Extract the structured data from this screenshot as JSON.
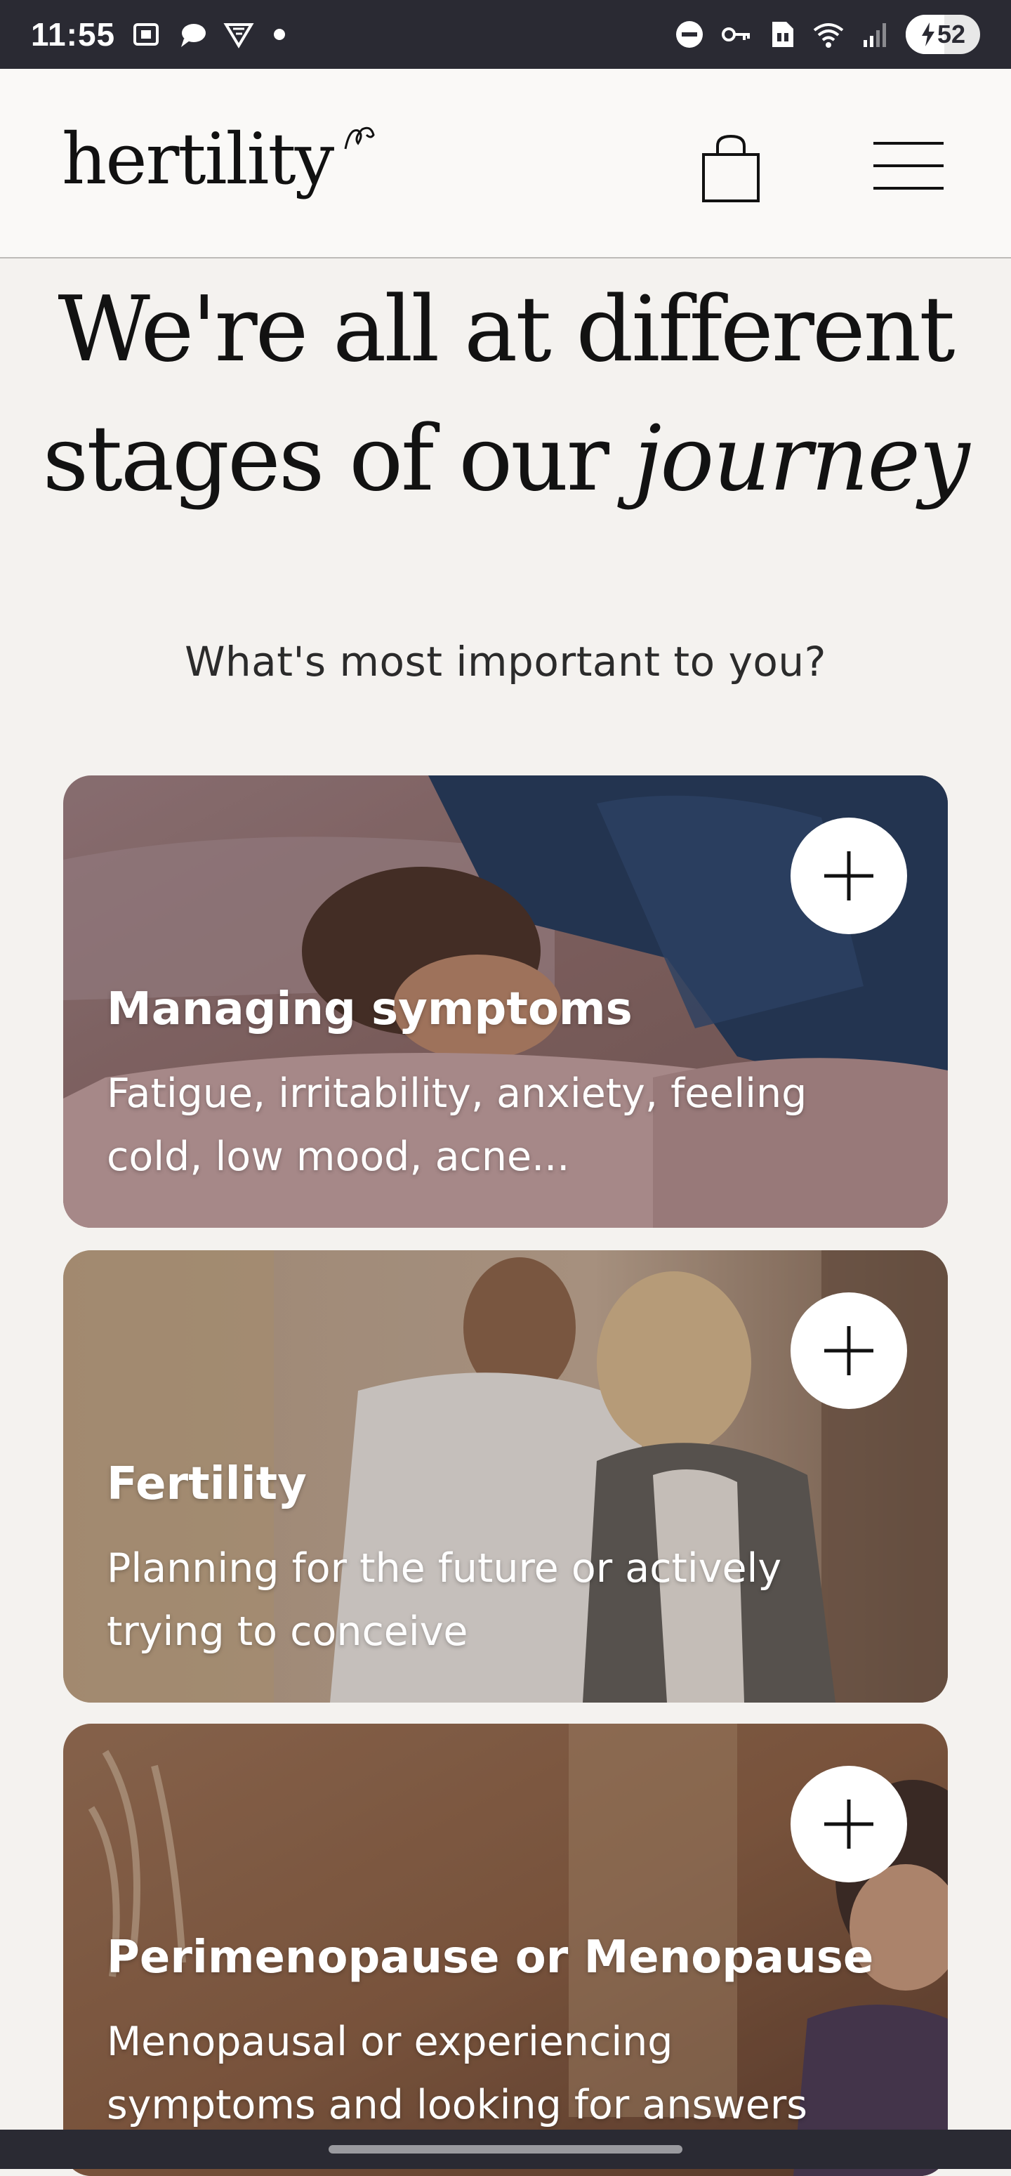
{
  "status_bar": {
    "time": "11:55",
    "battery": "52",
    "battery_level": 0.52,
    "left_icons": [
      "screenshot-icon",
      "message-icon",
      "filter-icon"
    ],
    "right_icons": [
      "dnd-icon",
      "vpn-key-icon",
      "sim-icon",
      "wifi-icon",
      "signal-icon"
    ]
  },
  "header": {
    "logo": "hertility",
    "icons": [
      "shopping-bag-icon",
      "hamburger-menu-icon"
    ]
  },
  "hero": {
    "title_line1": "We're all at different",
    "title_line2_plain": "stages of our",
    "title_line2_italic": "journey"
  },
  "subtitle": "What's most important to you?",
  "cards": [
    {
      "title": "Managing symptoms",
      "description": "Fatigue, irritability, anxiety, feeling cold, low mood, acne...",
      "icon": "plus-icon"
    },
    {
      "title": "Fertility",
      "description": "Planning for the future or actively trying to conceive",
      "icon": "plus-icon"
    },
    {
      "title": "Perimenopause or Menopause",
      "description": "Menopausal or experiencing symptoms and looking for answers",
      "icon": "plus-icon"
    }
  ],
  "colors": {
    "status_bar": "#2a2a33",
    "page_background": "#f4f2ef",
    "header_background": "#faf9f7",
    "text_dark": "#121212"
  }
}
